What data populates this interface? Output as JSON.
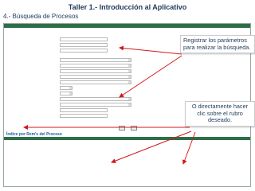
{
  "slide": {
    "title": "Taller 1.- Introducción al Aplicativo",
    "subtitle": "4.- Búsqueda de Procesos"
  },
  "callouts": {
    "register": "Registrar los parámetros para realizar la búsqueda.",
    "click_heading": "O directamente hacer clic sobre el rubro deseado."
  },
  "screenshot": {
    "colors": {
      "brand_green": "#2d6e47",
      "link_blue": "#1f5a96",
      "arrow_red": "#d11a1a"
    },
    "index_title": "Índice por Rem's del Proceso"
  }
}
